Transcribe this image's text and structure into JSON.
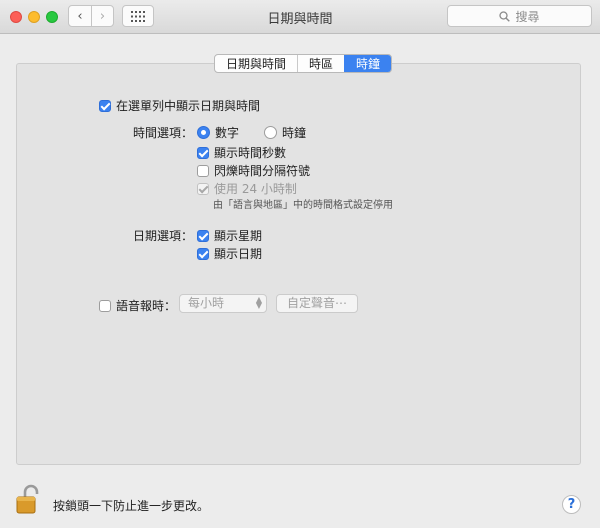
{
  "window": {
    "title": "日期與時間",
    "search_placeholder": "搜尋"
  },
  "toolbar": {
    "back_glyph": "‹",
    "forward_glyph": "›"
  },
  "tabs": [
    {
      "label": "日期與時間",
      "active": false
    },
    {
      "label": "時區",
      "active": false
    },
    {
      "label": "時鐘",
      "active": true
    }
  ],
  "clock": {
    "show_in_menubar": {
      "label": "在選單列中顯示日期與時間",
      "checked": true
    },
    "time_options": {
      "label": "時間選項：",
      "digital": {
        "label": "數字",
        "selected": true
      },
      "analog": {
        "label": "時鐘",
        "selected": false
      },
      "show_seconds": {
        "label": "顯示時間秒數",
        "checked": true
      },
      "flash_separators": {
        "label": "閃爍時間分隔符號",
        "checked": false
      },
      "use_24_hour": {
        "label": "使用 24 小時制",
        "checked": true,
        "disabled": true
      },
      "note": "由「語言與地區」中的時間格式設定停用"
    },
    "date_options": {
      "label": "日期選項：",
      "show_weekday": {
        "label": "顯示星期",
        "checked": true
      },
      "show_date": {
        "label": "顯示日期",
        "checked": true
      }
    },
    "announce": {
      "label": "語音報時：",
      "checked": false,
      "interval": "每小時",
      "customize_label": "自定聲音⋯"
    }
  },
  "footer": {
    "lock_text": "按鎖頭一下防止進一步更改。",
    "help_label": "?"
  },
  "icons": [
    "lock-icon",
    "search-icon",
    "grid-icon",
    "chevron-left-icon",
    "chevron-right-icon",
    "help-icon"
  ],
  "colors": {
    "accent": "#3b82f0"
  }
}
